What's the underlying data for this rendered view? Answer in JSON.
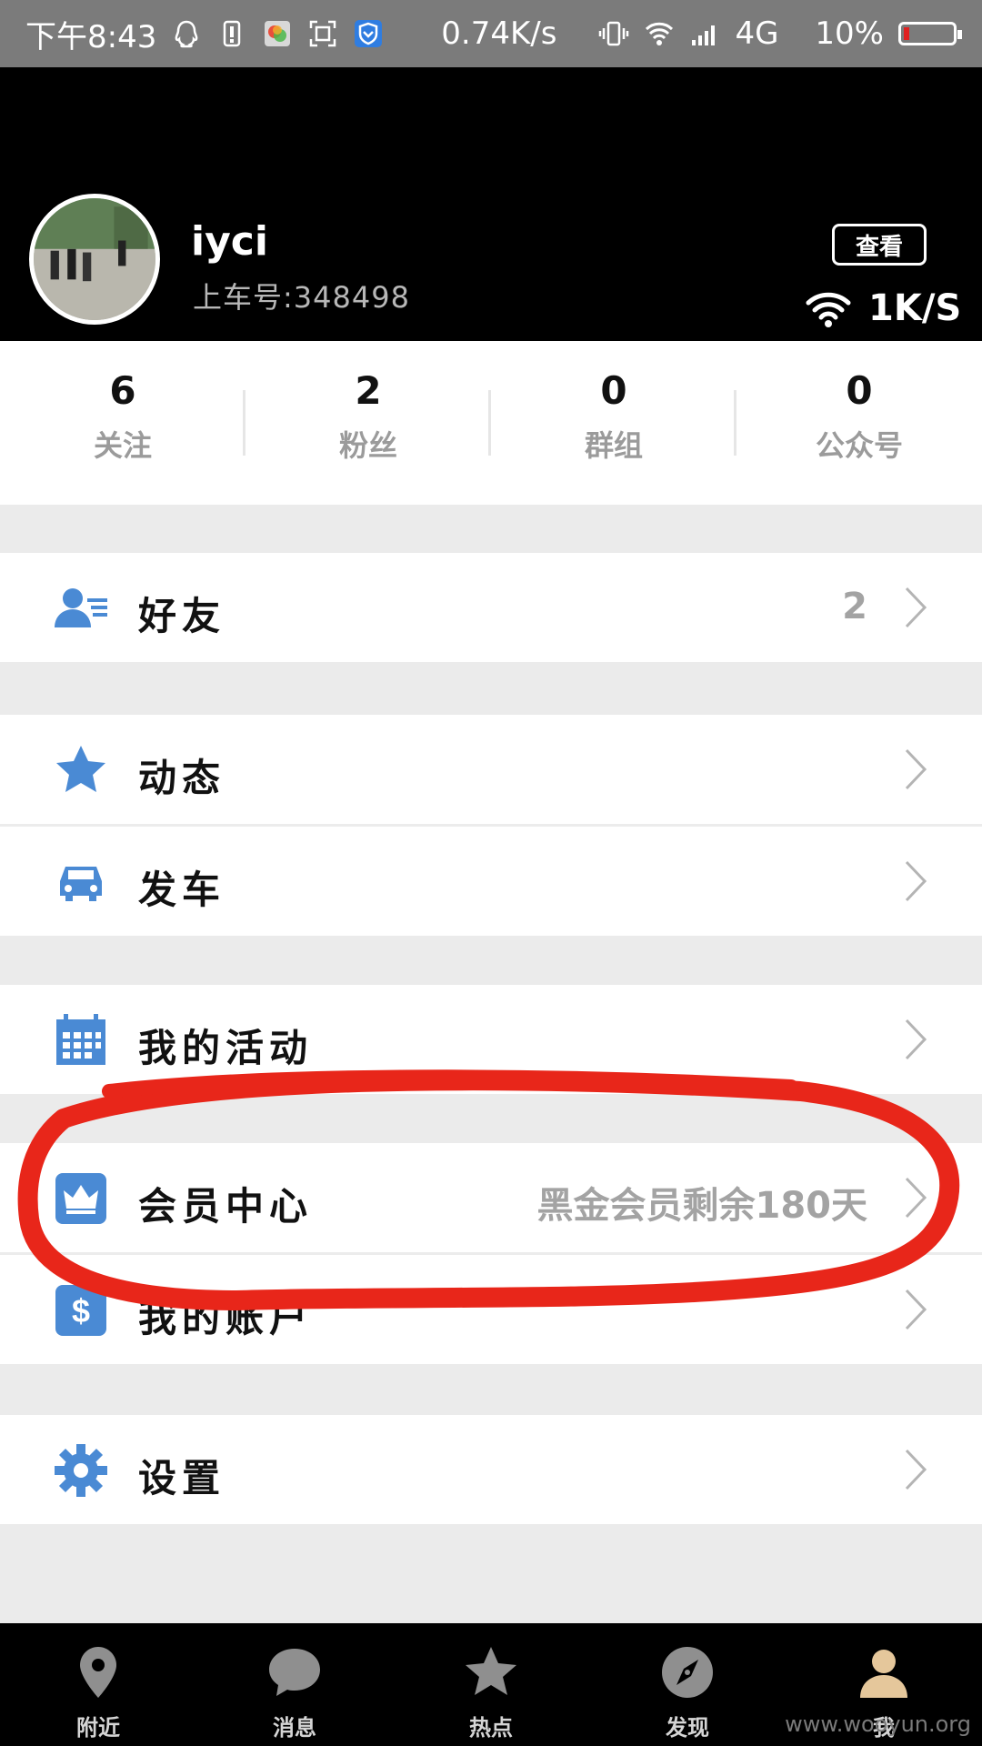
{
  "status_bar": {
    "time": "下午8:43",
    "net_speed": "0.74K/s",
    "network": "4G",
    "battery": "10%",
    "battery_level": 0.1
  },
  "profile": {
    "username": "iyci",
    "user_id": "上车号:348498",
    "view_button": "查看",
    "speed": "1K/S"
  },
  "stats": [
    {
      "value": "6",
      "label": "关注"
    },
    {
      "value": "2",
      "label": "粉丝"
    },
    {
      "value": "0",
      "label": "群组"
    },
    {
      "value": "0",
      "label": "公众号"
    }
  ],
  "menu": {
    "friends": {
      "label": "好友",
      "value": "2"
    },
    "moments": {
      "label": "动态"
    },
    "car": {
      "label": "发车"
    },
    "activities": {
      "label": "我的活动"
    },
    "membership": {
      "label": "会员中心",
      "value": "黑金会员剩余180天"
    },
    "account": {
      "label": "我的账户"
    },
    "settings": {
      "label": "设置"
    }
  },
  "tabs": [
    {
      "label": "附近",
      "icon": "location-pin-icon"
    },
    {
      "label": "消息",
      "icon": "chat-bubble-icon"
    },
    {
      "label": "热点",
      "icon": "star-icon"
    },
    {
      "label": "发现",
      "icon": "compass-icon"
    },
    {
      "label": "我",
      "icon": "person-icon"
    }
  ],
  "watermark": "www.wooyun.org",
  "colors": {
    "accent_blue": "#4a8ad4",
    "annotation_red": "#e8261a",
    "header_bg": "#000000",
    "status_bar_bg": "#7b7b7b"
  }
}
